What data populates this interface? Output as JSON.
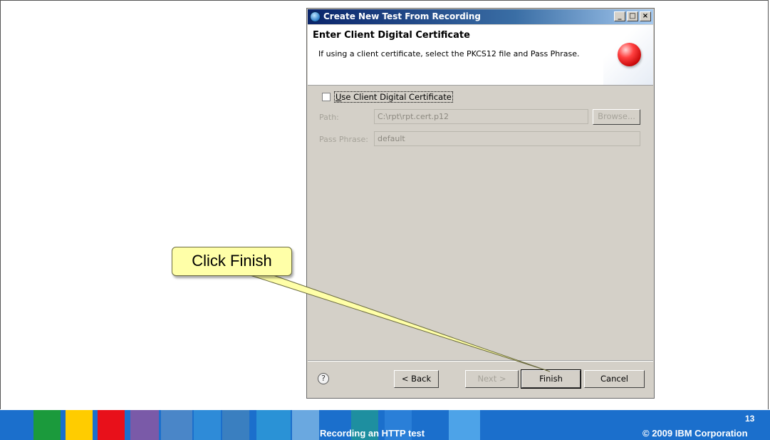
{
  "dialog": {
    "title": "Create New Test From Recording",
    "window_buttons": [
      "_",
      "□",
      "×"
    ],
    "header": {
      "title": "Enter Client Digital Certificate",
      "description": "If using a client certificate, select the PKCS12 file and Pass Phrase."
    },
    "use_certificate": {
      "label": "Use Client Digital Certificate",
      "checked": false
    },
    "path": {
      "label": "Path:",
      "value": "C:\\rpt\\rpt.cert.p12",
      "browse_label": "Browse..."
    },
    "pass_phrase": {
      "label": "Pass Phrase:",
      "value": "default"
    },
    "help_glyph": "?",
    "buttons": {
      "back": "< Back",
      "next": "Next >",
      "finish": "Finish",
      "cancel": "Cancel"
    }
  },
  "callout": {
    "text": "Click Finish"
  },
  "footer": {
    "page_number": "13",
    "subtitle": "Recording an HTTP test",
    "copyright": "© 2009 IBM Corporation",
    "colors": [
      "#1b9a3c",
      "#ffcc00",
      "#e8101a",
      "#7a5aa8",
      "#1b6fcc"
    ]
  }
}
